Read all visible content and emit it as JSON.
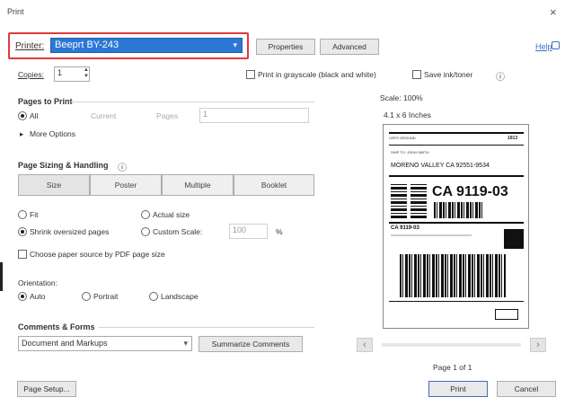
{
  "window": {
    "title": "Print",
    "close_glyph": "×"
  },
  "printer": {
    "label": "Printer:",
    "selected": "Beeprt BY-243",
    "chevron": "▾"
  },
  "top_buttons": {
    "properties": "Properties",
    "advanced": "Advanced",
    "help": "Help",
    "help_icon": "question-icon"
  },
  "copies": {
    "label": "Copies:",
    "value": "1"
  },
  "options": {
    "grayscale": "Print in grayscale (black and white)",
    "save_ink": "Save ink/toner",
    "info_glyph": "ⓘ"
  },
  "pages_to_print": {
    "header": "Pages to Print",
    "all": "All",
    "current": "Current",
    "pages": "Pages",
    "pages_value": "1",
    "more_options": "More Options"
  },
  "sizing": {
    "header": "Page Sizing & Handling",
    "info_glyph": "ⓘ",
    "tabs": [
      "Size",
      "Poster",
      "Multiple",
      "Booklet"
    ],
    "fit": "Fit",
    "actual_size": "Actual size",
    "shrink": "Shrink oversized pages",
    "custom_scale": "Custom Scale:",
    "custom_value": "100",
    "percent": "%",
    "pdf_paper": "Choose paper source by PDF page size"
  },
  "orientation": {
    "header": "Orientation:",
    "auto": "Auto",
    "portrait": "Portrait",
    "landscape": "Landscape"
  },
  "comments": {
    "header": "Comments & Forms",
    "selected": "Document and Markups",
    "summarize": "Summarize Comments"
  },
  "preview": {
    "scale": "Scale: 100%",
    "size": "4.1 x 6 Inches",
    "label_top_left": "USPS GROUND",
    "label_top_right": "1913",
    "ship_to": "SHIP TO: JOHN SMITH",
    "address": "MORENO VALLEY CA 92551-9534",
    "big_code": "CA 9119-03",
    "small_code": "CA 9119-03",
    "page": "Page 1 of 1",
    "prev": "‹",
    "next": "›"
  },
  "footer": {
    "page_setup": "Page Setup...",
    "print": "Print",
    "cancel": "Cancel"
  }
}
